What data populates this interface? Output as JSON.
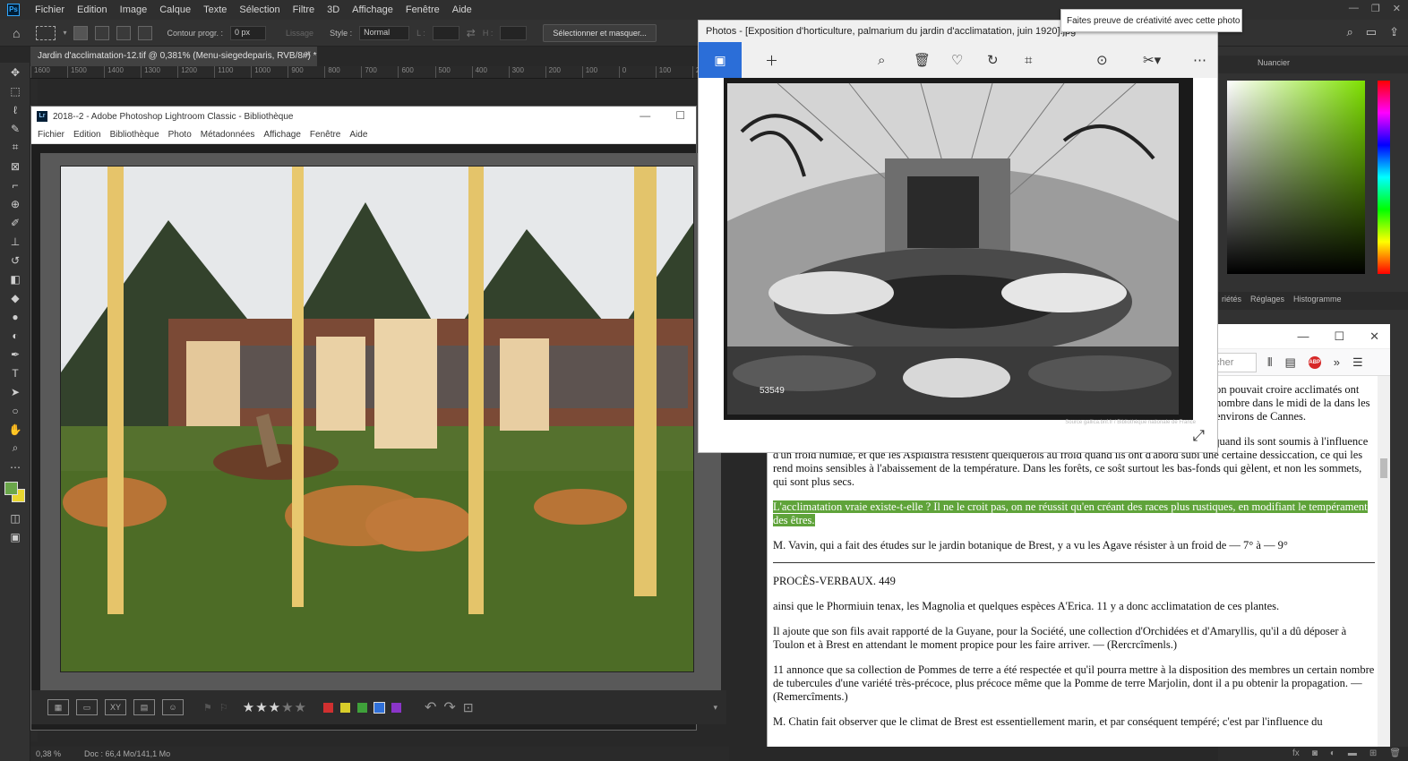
{
  "ps": {
    "logo": "Ps",
    "menu": [
      "Fichier",
      "Edition",
      "Image",
      "Calque",
      "Texte",
      "Sélection",
      "Filtre",
      "3D",
      "Affichage",
      "Fenêtre",
      "Aide"
    ],
    "options": {
      "contour_label": "Contour progr. :",
      "contour_value": "0 px",
      "lissage_label": "Lissage",
      "style_label": "Style :",
      "style_value": "Normal",
      "l_label": "L :",
      "h_label": "H :",
      "select_mask_button": "Sélectionner et masquer..."
    },
    "doc_tab": "Jardin d'acclimatation-12.tif @ 0,381% (Menu-siegedeparis, RVB/8#) *",
    "ruler_ticks": [
      "1600",
      "1500",
      "1400",
      "1300",
      "1200",
      "1100",
      "1000",
      "900",
      "800",
      "700",
      "600",
      "500",
      "400",
      "300",
      "200",
      "100",
      "0",
      "100",
      "200"
    ],
    "status": {
      "zoom": "0,38 %",
      "doc": "Doc : 66,4 Mo/141,1 Mo"
    },
    "right_tabs_top": [
      "Nuancier"
    ],
    "right_tabs_mid": [
      "riétés",
      "Réglages",
      "Histogramme"
    ]
  },
  "lightroom": {
    "logo": "Lr",
    "title": "2018--2 - Adobe Photoshop Lightroom Classic - Bibliothèque",
    "menu": [
      "Fichier",
      "Edition",
      "Bibliothèque",
      "Photo",
      "Métadonnées",
      "Affichage",
      "Fenêtre",
      "Aide"
    ],
    "rating_stars": 3,
    "stars": "★★★★★"
  },
  "photos": {
    "title": "Photos - [Exposition d'horticulture, palmarium du jardin d'acclimatation, juin 1920].jpg",
    "tooltip": "Faites preuve de créativité avec cette photo",
    "credit": "Source gallica.bnf.fr / Bibliothèque nationale de France",
    "plate_number": "53549"
  },
  "firefox": {
    "search_placeholder": "cher",
    "abp_label": "ABP",
    "paragraphs": [
      "on pouvait croire acclimatés ont nombre dans le midi de la dans les environs de Cannes.",
      ", a également gelé dans une grande partie du Midi. On sait que les Oliviers périssent dans le Midi, quand ils sont soumis à l'influence d'un froid humide, et que les Aspidistra résistent quelquefois au froid quand ils ont d'abord subi une certaine dessiccation, ce qui les rend moins sensibles à l'abaissement de la température. Dans les forêts, ce soŝt surtout les bas-fonds qui gèlent, et non les sommets, qui sont plus secs.",
      "L'acclimatation vraie existe-t-elle ? Il ne le croit pas, on ne réussit qu'en créant des races plus rustiques, en modifiant le tempérament des êtres.",
      "M. Vavin, qui a fait des études sur le jardin botanique de Brest, y a vu les Agave résister à un froid de — 7° à — 9°",
      "PROCÈS-VERBAUX. 449",
      "ainsi que le Phormiuin tenax, les Magnolia et quelques espèces A'Erica. 11 y a donc acclimatation de ces plantes.",
      "Il ajoute que son fils avait rapporté de la Guyane, pour la Société, une collection d'Orchidées et d'Amaryllis, qu'il a dû déposer à Toulon et à Brest en attendant le moment propice pour les faire arriver. — (Rercrcîmenls.)",
      "11 annonce que sa collection de Pommes de terre a été respectée et qu'il pourra mettre à la disposition des membres un certain nombre de tubercules d'une variété très-précoce, plus précoce même que la Pomme de terre Marjolin, dont il a pu obtenir la propagation. — (Remercîments.)",
      "M. Chatin fait observer que le climat de Brest est essentiellement marin, et par conséquent tempéré; c'est par l'influence du"
    ]
  },
  "colors": {
    "accent": "#2b6ed8",
    "highlight": "#5fa33a",
    "fg": "#6aa64a",
    "bg": "#e8d630"
  }
}
